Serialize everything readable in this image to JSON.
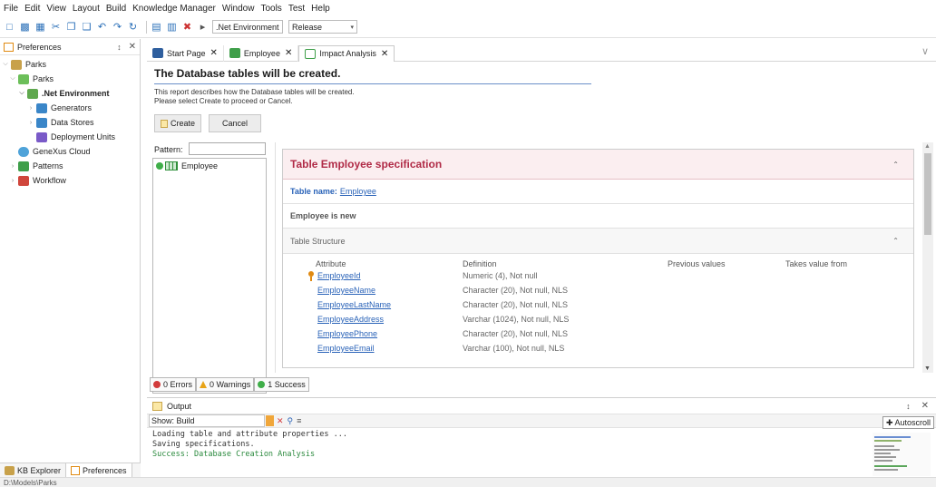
{
  "menu": [
    "File",
    "Edit",
    "View",
    "Layout",
    "Build",
    "Knowledge Manager",
    "Window",
    "Tools",
    "Test",
    "Help"
  ],
  "toolbar": {
    "environment": ".Net Environment",
    "configuration": "Release"
  },
  "left_panel": {
    "title": "Preferences",
    "tree": [
      {
        "label": "Parks",
        "level": 0,
        "icon": "kb-icon",
        "bold": false
      },
      {
        "label": "Parks",
        "level": 1,
        "icon": "version-icon",
        "bold": false
      },
      {
        "label": ".Net Environment",
        "level": 2,
        "icon": "environment-icon",
        "bold": true
      },
      {
        "label": "Generators",
        "level": 3,
        "icon": "generators-icon",
        "bold": false
      },
      {
        "label": "Data Stores",
        "level": 3,
        "icon": "datastores-icon",
        "bold": false
      },
      {
        "label": "Deployment Units",
        "level": 3,
        "icon": "rocket-icon",
        "bold": false
      },
      {
        "label": "GeneXus Cloud",
        "level": 1,
        "icon": "cloud-icon",
        "bold": false
      },
      {
        "label": "Patterns",
        "level": 1,
        "icon": "patterns-icon",
        "bold": false
      },
      {
        "label": "Workflow",
        "level": 1,
        "icon": "workflow-icon",
        "bold": false
      }
    ],
    "bottom_tabs": [
      "KB Explorer",
      "Preferences"
    ]
  },
  "tabs": [
    {
      "label": "Start Page",
      "icon": "gx-icon"
    },
    {
      "label": "Employee",
      "icon": "table-icon"
    },
    {
      "label": "Impact Analysis",
      "icon": "impact-icon"
    }
  ],
  "report": {
    "title": "The Database tables will be created.",
    "desc_line1": "This report describes how the Database tables will be created.",
    "desc_line2": "Please select Create to proceed or Cancel.",
    "create_label": "Create",
    "cancel_label": "Cancel"
  },
  "pattern": {
    "label": "Pattern:",
    "value": ""
  },
  "objects": [
    "Employee"
  ],
  "spec": {
    "title": "Table Employee specification",
    "table_name_label": "Table name:",
    "table_name_value": "Employee",
    "status": "Employee is new",
    "structure_label": "Table Structure",
    "columns": [
      "Attribute",
      "Definition",
      "Previous values",
      "Takes value from"
    ],
    "rows": [
      {
        "attribute": "EmployeeId",
        "definition": "Numeric (4), Not null",
        "key": true
      },
      {
        "attribute": "EmployeeName",
        "definition": "Character (20), Not null, NLS",
        "key": false
      },
      {
        "attribute": "EmployeeLastName",
        "definition": "Character (20), Not null, NLS",
        "key": false
      },
      {
        "attribute": "EmployeeAddress",
        "definition": "Varchar (1024), Not null, NLS",
        "key": false
      },
      {
        "attribute": "EmployeePhone",
        "definition": "Character (20), Not null, NLS",
        "key": false
      },
      {
        "attribute": "EmployeeEmail",
        "definition": "Varchar (100), Not null, NLS",
        "key": false
      }
    ]
  },
  "status": {
    "errors": "0 Errors",
    "warnings": "0 Warnings",
    "success": "1 Success"
  },
  "output": {
    "title": "Output",
    "show_label": "Show: Build",
    "log": [
      {
        "text": "Loading table and attribute properties ...",
        "success": false
      },
      {
        "text": "Saving specifications.",
        "success": false
      },
      {
        "text": "Success: Database Creation Analysis",
        "success": true
      }
    ],
    "autoscroll_label": "Autoscroll"
  },
  "bottom_status": "D:\\Models\\Parks",
  "colors": {
    "accent": "#2a63b8",
    "spec_title": "#b02a46",
    "success": "#3fae49",
    "warning": "#e8a317",
    "error": "#d23b3b"
  }
}
